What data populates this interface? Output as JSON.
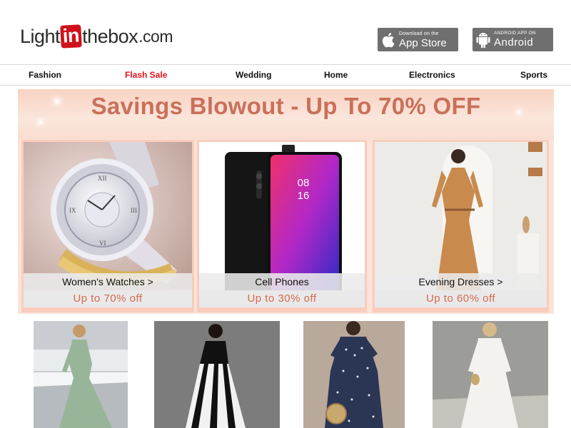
{
  "header": {
    "logo": {
      "part1": "Light",
      "part2": "in",
      "part3": "thebox",
      "part4": ".com"
    },
    "app_store": {
      "small": "Download on the",
      "big": "App Store",
      "icon": "apple-icon"
    },
    "android": {
      "small": "ANDROID APP ON",
      "big": "Android",
      "icon": "android-icon"
    }
  },
  "nav": {
    "items": [
      {
        "label": "Fashion"
      },
      {
        "label": "Flash Sale"
      },
      {
        "label": "Wedding"
      },
      {
        "label": "Home"
      },
      {
        "label": "Electronics"
      },
      {
        "label": "Sports"
      }
    ],
    "sale_color": "#e3141b"
  },
  "promo": {
    "title": "Savings Blowout - Up To 70% OFF",
    "title_color": "#c9705a",
    "cards": [
      {
        "caption": "Women's Watches >",
        "discount": "Up to 70% off"
      },
      {
        "caption": "Cell Phones",
        "discount": "Up to 30% off"
      },
      {
        "caption": "Evening Dresses >",
        "discount": "Up to 60% off"
      }
    ]
  },
  "products": [
    {
      "name": "sage-green-maxi-dress"
    },
    {
      "name": "black-white-striped-maxi-dress"
    },
    {
      "name": "navy-polka-dot-dress"
    },
    {
      "name": "white-lace-maxi-dress"
    }
  ]
}
